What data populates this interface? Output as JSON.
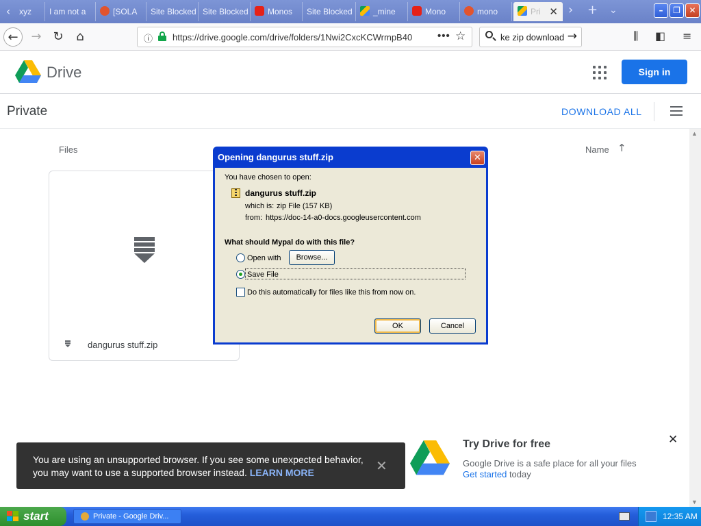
{
  "browser": {
    "tabs": [
      {
        "label": "xyz"
      },
      {
        "label": "I am not a"
      },
      {
        "label": "[SOLA"
      },
      {
        "label": "Site Blocked"
      },
      {
        "label": "Site Blocked"
      },
      {
        "label": "Monos"
      },
      {
        "label": "Site Blocked"
      },
      {
        "label": "_mine"
      },
      {
        "label": "Mono"
      },
      {
        "label": "mono"
      },
      {
        "label": "Pri"
      }
    ],
    "url": "https://drive.google.com/drive/folders/1Nwi2CxcKCWrmpB40",
    "search_text": "ke zip download"
  },
  "drive": {
    "app_name": "Drive",
    "sign_in_label": "Sign in",
    "folder_title": "Private",
    "download_all_label": "DOWNLOAD ALL",
    "files_label": "Files",
    "sort_label": "Name",
    "file": {
      "name": "dangurus stuff.zip"
    }
  },
  "toast": {
    "message": "You are using an unsupported browser. If you see some unexpected behavior, you may want to use a supported browser instead.",
    "link_label": "LEARN MORE"
  },
  "promo": {
    "title": "Try Drive for free",
    "description": "Google Drive is a safe place for all your files",
    "cta_link": "Get started",
    "cta_suffix": "today"
  },
  "dialog": {
    "title": "Opening dangurus stuff.zip",
    "intro": "You have chosen to open:",
    "filename": "dangurus stuff.zip",
    "which_is_label": "which is:",
    "which_is_value": "zip File (157 KB)",
    "from_label": "from:",
    "from_value": "https://doc-14-a0-docs.googleusercontent.com",
    "question": "What should Mypal do with this file?",
    "open_with_label": "Open with",
    "browse_label": "Browse...",
    "save_file_label": "Save File",
    "auto_label": "Do this automatically for files like this from now on.",
    "ok_label": "OK",
    "cancel_label": "Cancel",
    "selected_option": "Save File"
  },
  "taskbar": {
    "start_label": "start",
    "task_label": "Private - Google Driv...",
    "clock": "12:35 AM"
  }
}
